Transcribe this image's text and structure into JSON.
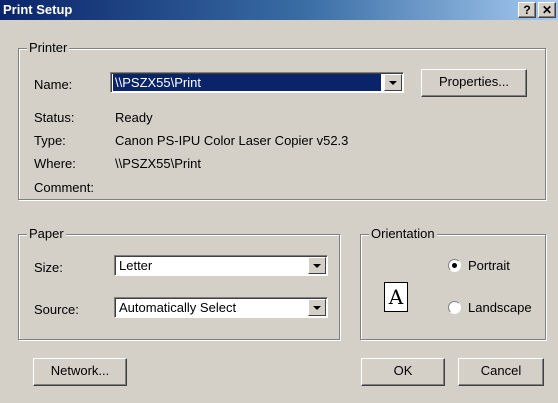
{
  "window": {
    "title": "Print Setup",
    "help_icon": "help-icon",
    "close_icon": "close-icon"
  },
  "printer": {
    "group_label": "Printer",
    "name_label": "Name:",
    "name_value": "\\\\PSZX55\\Print",
    "properties_label": "Properties...",
    "status_label": "Status:",
    "status_value": "Ready",
    "type_label": "Type:",
    "type_value": "Canon PS-IPU Color Laser Copier v52.3",
    "where_label": "Where:",
    "where_value": "\\\\PSZX55\\Print",
    "comment_label": "Comment:"
  },
  "paper": {
    "group_label": "Paper",
    "size_label": "Size:",
    "size_value": "Letter",
    "source_label": "Source:",
    "source_value": "Automatically Select"
  },
  "orientation": {
    "group_label": "Orientation",
    "page_glyph": "A",
    "portrait_label": "Portrait",
    "landscape_label": "Landscape",
    "selected": "Portrait"
  },
  "buttons": {
    "network": "Network...",
    "ok": "OK",
    "cancel": "Cancel"
  },
  "colors": {
    "face": "#d4d0c8",
    "title_start": "#0a246a",
    "title_end": "#a6caf0",
    "selection": "#0a246a"
  }
}
